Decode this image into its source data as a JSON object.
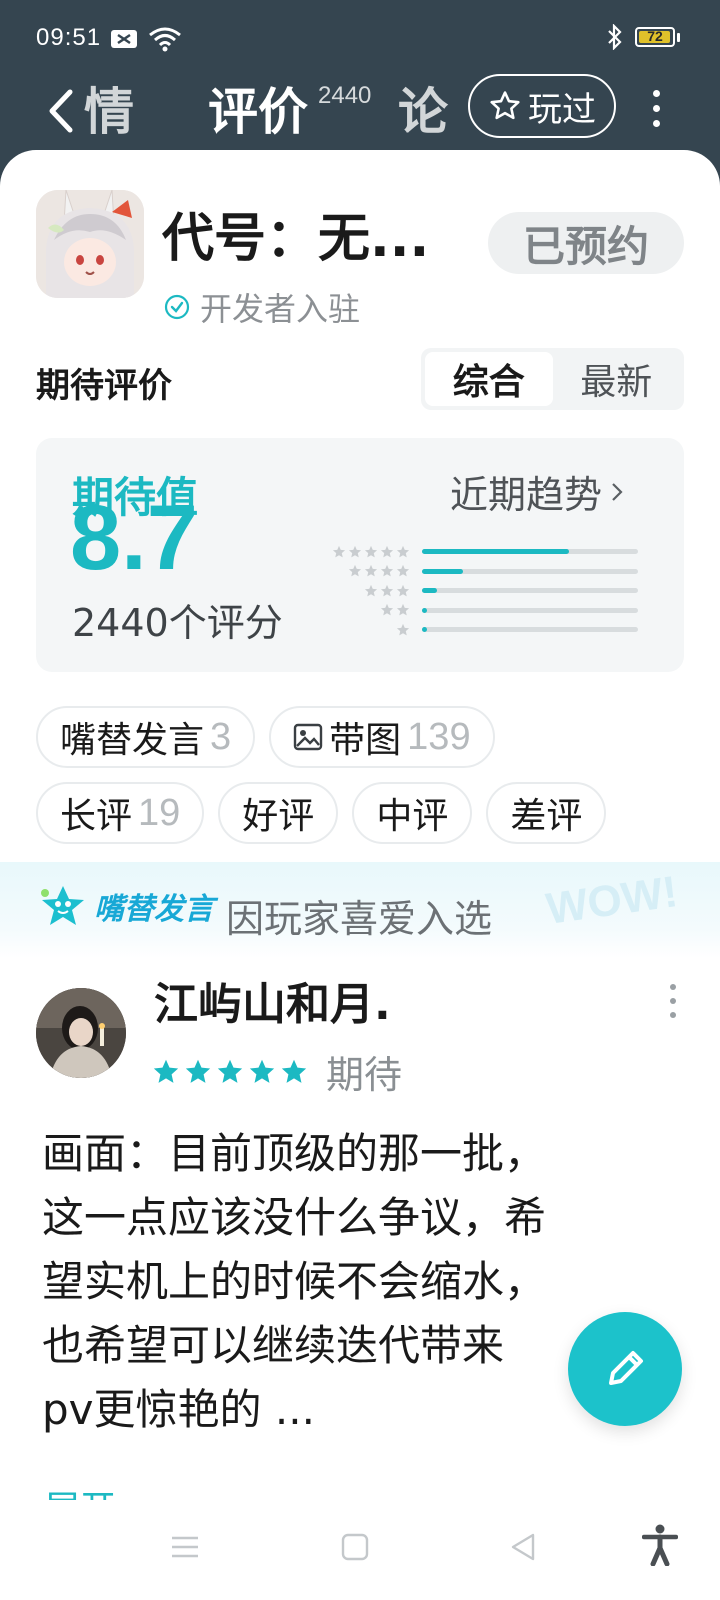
{
  "status_bar": {
    "time": "09:51",
    "battery": "72"
  },
  "nav": {
    "tab_details": "情",
    "tab_reviews": "评价",
    "tab_reviews_count": "2440",
    "tab_forum": "论",
    "played_label": "玩过"
  },
  "game": {
    "title": "代号：无...",
    "verified_label": "开发者入驻",
    "reserve_label": "已预约"
  },
  "ratings": {
    "section_title": "期待评价",
    "sort_options": [
      "综合",
      "最新"
    ],
    "selected_sort": "综合",
    "score_label": "期待值",
    "score_value": "8.7",
    "count_label": "2440个评分",
    "trend_label": "近期趋势",
    "distribution": [
      {
        "stars": 5,
        "fraction": 0.68
      },
      {
        "stars": 4,
        "fraction": 0.19
      },
      {
        "stars": 3,
        "fraction": 0.07
      },
      {
        "stars": 2,
        "fraction": 0.02
      },
      {
        "stars": 1,
        "fraction": 0.02
      }
    ]
  },
  "filters": {
    "row1": [
      {
        "label": "嘴替发言",
        "count": "3",
        "icon": ""
      },
      {
        "label": "带图",
        "count": "139",
        "icon": "image-icon"
      }
    ],
    "row2": [
      {
        "label": "长评",
        "count": "19"
      },
      {
        "label": "好评",
        "count": ""
      },
      {
        "label": "中评",
        "count": ""
      },
      {
        "label": "差评",
        "count": ""
      }
    ]
  },
  "featured": {
    "logo_text": "嘴替发言",
    "reason": "因玩家喜爱入选",
    "decor_text": "WOW!"
  },
  "review": {
    "author": "江屿山和月.",
    "stars": 5,
    "rating_label": "期待",
    "lines": [
      "画面：目前顶级的那一批，",
      "这一点应该没什么争议，希",
      "望实机上的时候不会缩水，",
      "也希望可以继续迭代带来",
      "pv更惊艳的 ..."
    ],
    "expand_label": "展开"
  },
  "colors": {
    "accent": "#1cb9c2",
    "header_bg": "#354550"
  }
}
